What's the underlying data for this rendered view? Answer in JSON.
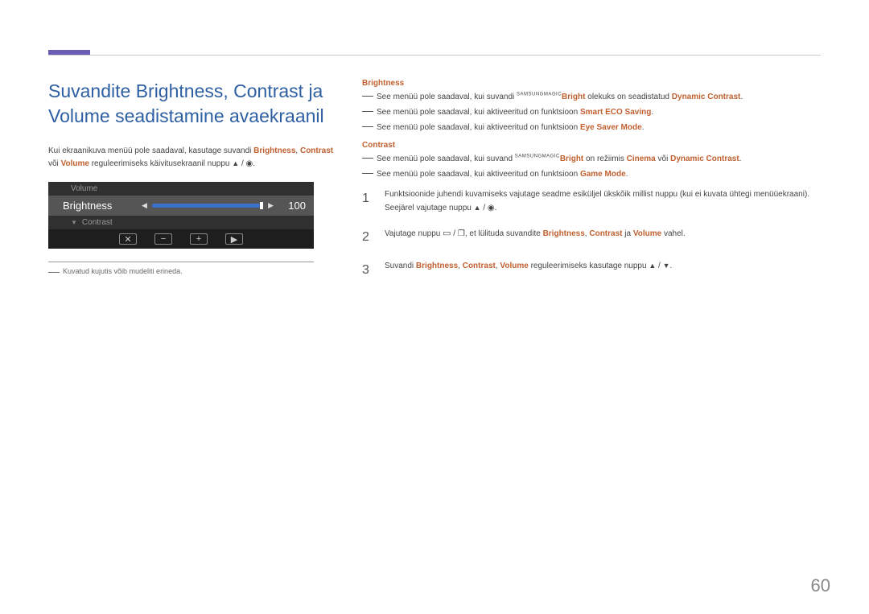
{
  "title": "Suvandite Brightness, Contrast ja Volume seadistamine avaekraanil",
  "intro": {
    "pre": "Kui ekraanikuva menüü pole saadaval, kasutage suvandi ",
    "kw1": "Brightness",
    "sep1": ", ",
    "kw2": "Contrast",
    "mid": " või ",
    "kw3": "Volume",
    "post": " reguleerimiseks käivitusekraanil nuppu ",
    "btn1": "▲",
    "btn_sep": " / ",
    "btn2": "◉",
    "end": "."
  },
  "osd": {
    "dim_top": "Volume",
    "selected_label": "Brightness",
    "value": "100",
    "dim_bottom": "Contrast"
  },
  "footnote": "Kuvatud kujutis võib mudeliti erineda.",
  "section_brightness": "Brightness",
  "b_notes": [
    {
      "pre": "See menüü pole saadaval, kui suvandi ",
      "magic_pre": "SAMSUNG",
      "magic": "MAGIC",
      "kw1": "Bright",
      "mid": " olekuks on seadistatud ",
      "kw2": "Dynamic Contrast",
      "end": "."
    },
    {
      "pre": "See menüü pole saadaval, kui aktiveeritud on funktsioon ",
      "kw1": "Smart ECO Saving",
      "end": "."
    },
    {
      "pre": "See menüü pole saadaval, kui aktiveeritud on funktsioon ",
      "kw1": "Eye Saver Mode",
      "end": "."
    }
  ],
  "section_contrast": "Contrast",
  "c_notes": [
    {
      "pre": "See menüü pole saadaval, kui suvand ",
      "magic_pre": "SAMSUNG",
      "magic": "MAGIC",
      "kw1": "Bright",
      "mid": " on režiimis ",
      "kw2": "Cinema",
      "mid2": " või ",
      "kw3": "Dynamic Contrast",
      "end": "."
    },
    {
      "pre": "See menüü pole saadaval, kui aktiveeritud on funktsioon ",
      "kw1": "Game Mode",
      "end": "."
    }
  ],
  "steps": [
    {
      "num": "1",
      "l1": "Funktsioonide juhendi kuvamiseks vajutage seadme esiküljel ükskõik millist nuppu (kui ei kuvata ühtegi menüüekraani).",
      "l2_pre": "Seejärel vajutage nuppu ",
      "l2_b1": "▲",
      "l2_sep": " / ",
      "l2_b2": "◉",
      "l2_end": "."
    },
    {
      "num": "2",
      "pre": "Vajutage nuppu ",
      "b1": "▭",
      "sep": " / ",
      "b2": "❐",
      "mid": ", et lülituda suvandite ",
      "kw1": "Brightness",
      "s1": ", ",
      "kw2": "Contrast",
      "s2": " ja ",
      "kw3": "Volume",
      "end": " vahel."
    },
    {
      "num": "3",
      "pre": "Suvandi ",
      "kw1": "Brightness",
      "s1": ", ",
      "kw2": "Contrast",
      "s2": ", ",
      "kw3": "Volume",
      "mid": " reguleerimiseks kasutage nuppu ",
      "b1": "▲",
      "sep": " / ",
      "b2": "▼",
      "end": "."
    }
  ],
  "page_number": "60"
}
